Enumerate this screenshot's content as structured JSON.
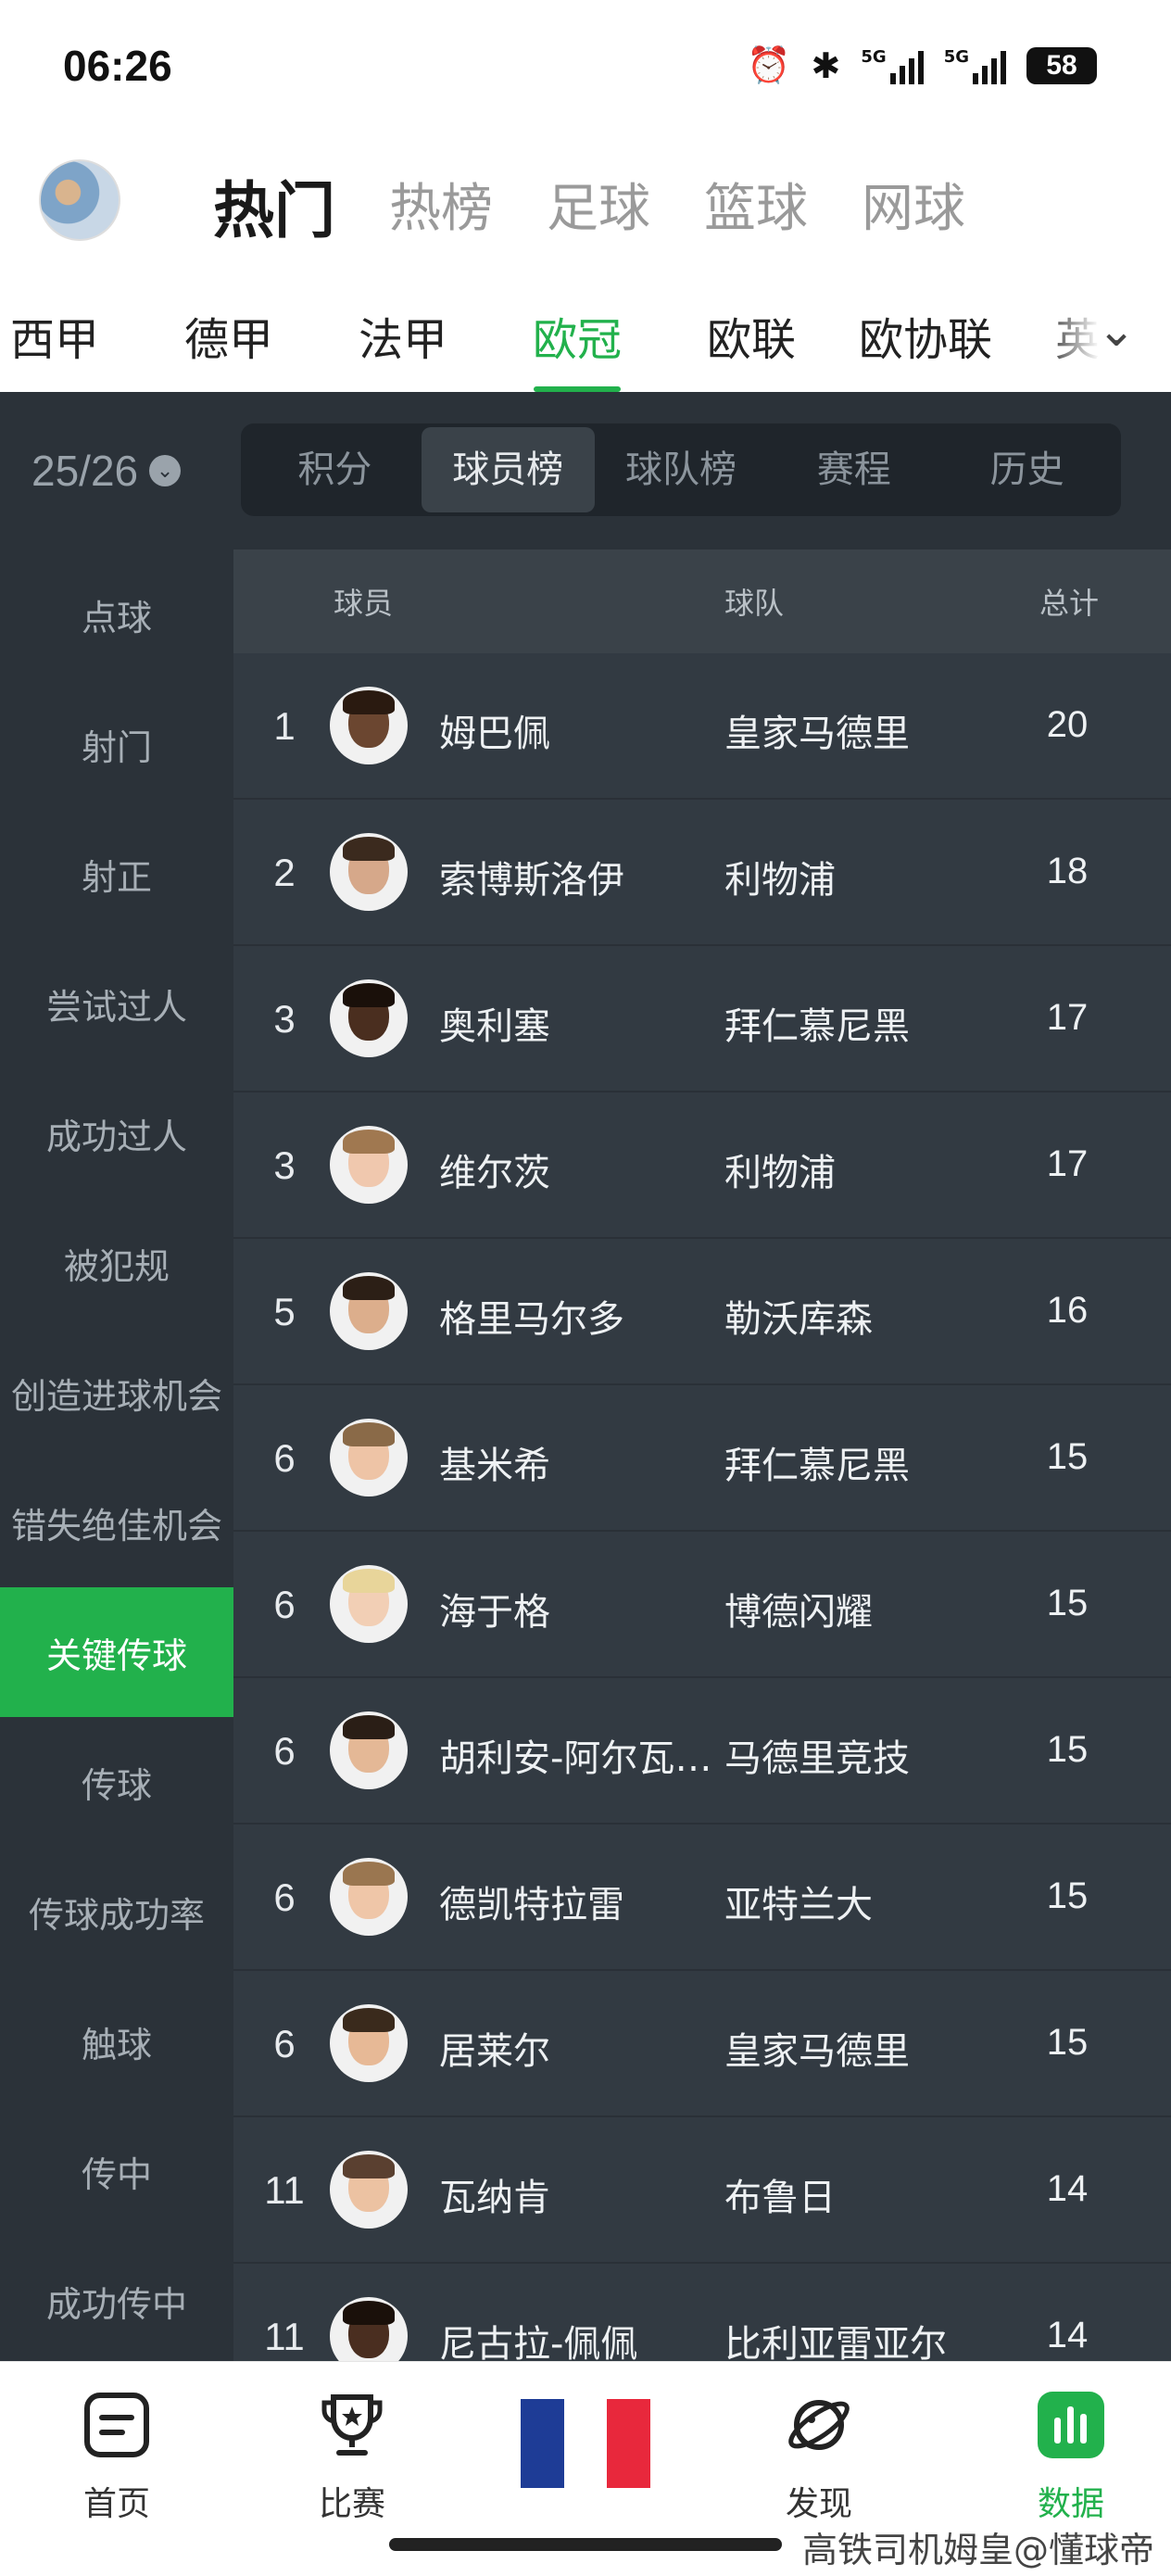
{
  "status_bar": {
    "time": "06:26",
    "battery": "58",
    "net1": "5G",
    "net2": "5G"
  },
  "top_tabs": [
    {
      "label": "热门",
      "active": true
    },
    {
      "label": "热榜",
      "active": false
    },
    {
      "label": "足球",
      "active": false
    },
    {
      "label": "篮球",
      "active": false
    },
    {
      "label": "网球",
      "active": false
    }
  ],
  "leagues": [
    {
      "label": "西甲",
      "active": false
    },
    {
      "label": "德甲",
      "active": false
    },
    {
      "label": "法甲",
      "active": false
    },
    {
      "label": "欧冠",
      "active": true
    },
    {
      "label": "欧联",
      "active": false
    },
    {
      "label": "欧协联",
      "active": false
    },
    {
      "label": "英超",
      "active": false
    }
  ],
  "season": "25/26",
  "sub_tabs": [
    {
      "label": "积分",
      "active": false
    },
    {
      "label": "球员榜",
      "active": true
    },
    {
      "label": "球队榜",
      "active": false
    },
    {
      "label": "赛程",
      "active": false
    },
    {
      "label": "历史",
      "active": false
    }
  ],
  "categories": [
    {
      "label": "点球",
      "active": false
    },
    {
      "label": "射门",
      "active": false
    },
    {
      "label": "射正",
      "active": false
    },
    {
      "label": "尝试过人",
      "active": false
    },
    {
      "label": "成功过人",
      "active": false
    },
    {
      "label": "被犯规",
      "active": false
    },
    {
      "label": "创造进球机会",
      "active": false
    },
    {
      "label": "错失绝佳机会",
      "active": false
    },
    {
      "label": "关键传球",
      "active": true
    },
    {
      "label": "传球",
      "active": false
    },
    {
      "label": "传球成功率",
      "active": false
    },
    {
      "label": "触球",
      "active": false
    },
    {
      "label": "传中",
      "active": false
    },
    {
      "label": "成功传中",
      "active": false
    }
  ],
  "table": {
    "headers": {
      "player": "球员",
      "team": "球队",
      "total": "总计"
    },
    "rows": [
      {
        "rank": "1",
        "name": "姆巴佩",
        "team": "皇家马德里",
        "total": "20",
        "skin": "#6b4630",
        "hair": "#2a1a10"
      },
      {
        "rank": "2",
        "name": "索博斯洛伊",
        "team": "利物浦",
        "total": "18",
        "skin": "#d6a88a",
        "hair": "#3b2a1e"
      },
      {
        "rank": "3",
        "name": "奥利塞",
        "team": "拜仁慕尼黑",
        "total": "17",
        "skin": "#4a2e1f",
        "hair": "#1a100a"
      },
      {
        "rank": "3",
        "name": "维尔茨",
        "team": "利物浦",
        "total": "17",
        "skin": "#f0c8ae",
        "hair": "#a07850"
      },
      {
        "rank": "5",
        "name": "格里马尔多",
        "team": "勒沃库森",
        "total": "16",
        "skin": "#dcae8c",
        "hair": "#2c1f16"
      },
      {
        "rank": "6",
        "name": "基米希",
        "team": "拜仁慕尼黑",
        "total": "15",
        "skin": "#eec4a6",
        "hair": "#8a6a48"
      },
      {
        "rank": "6",
        "name": "海于格",
        "team": "博德闪耀",
        "total": "15",
        "skin": "#f2cfb5",
        "hair": "#e8d59a"
      },
      {
        "rank": "6",
        "name": "胡利安-阿尔瓦雷斯",
        "team": "马德里竞技",
        "total": "15",
        "skin": "#e4b896",
        "hair": "#2a1e16"
      },
      {
        "rank": "6",
        "name": "德凯特拉雷",
        "team": "亚特兰大",
        "total": "15",
        "skin": "#efc6a8",
        "hair": "#9a7650"
      },
      {
        "rank": "6",
        "name": "居莱尔",
        "team": "皇家马德里",
        "total": "15",
        "skin": "#e7b996",
        "hair": "#3a2a1c"
      },
      {
        "rank": "11",
        "name": "瓦纳肯",
        "team": "布鲁日",
        "total": "14",
        "skin": "#ecc2a2",
        "hair": "#5a4030"
      },
      {
        "rank": "11",
        "name": "尼古拉-佩佩",
        "team": "比利亚雷亚尔",
        "total": "14",
        "skin": "#4a2e20",
        "hair": "#1a100a"
      }
    ]
  },
  "bottom_nav": [
    {
      "label": "首页",
      "active": false
    },
    {
      "label": "比赛",
      "active": false
    },
    {
      "label": "发现",
      "active": false
    },
    {
      "label": "数据",
      "active": true
    }
  ],
  "watermark": "高铁司机姆皇@懂球帝",
  "colors": {
    "accent": "#22b14c",
    "panel": "#2b3239",
    "table_bg": "#323a42"
  },
  "icons": [
    "alarm-icon",
    "bluetooth-icon",
    "signal-icon",
    "chevron-down-icon",
    "home-icon",
    "trophy-icon",
    "france-flag-icon",
    "planet-icon",
    "data-icon"
  ]
}
